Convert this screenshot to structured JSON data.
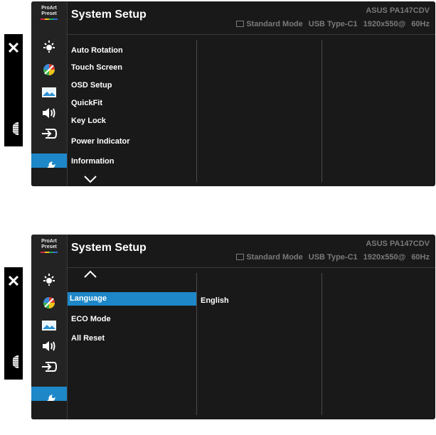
{
  "screen1": {
    "proart_line1": "ProArt",
    "proart_line2": "Preset",
    "title": "System Setup",
    "model": "ASUS PA147CDV",
    "status": {
      "mode": "Standard Mode",
      "input": "USB Type-C1",
      "resolution": "1920x550@",
      "refresh": "60Hz"
    },
    "menu_items": [
      "Auto Rotation",
      "Touch Screen",
      "OSD Setup",
      "QuickFit",
      "Key Lock",
      "Power Indicator",
      "Information"
    ],
    "scroll_icon": "chevron-down-icon"
  },
  "screen2": {
    "proart_line1": "ProArt",
    "proart_line2": "Preset",
    "title": "System Setup",
    "model": "ASUS PA147CDV",
    "status": {
      "mode": "Standard Mode",
      "input": "USB Type-C1",
      "resolution": "1920x550@",
      "refresh": "60Hz"
    },
    "menu_items": [
      "Language",
      "ECO Mode",
      "All Reset"
    ],
    "selected_item": "Language",
    "selected_value": "English",
    "scroll_icon": "chevron-up-icon"
  },
  "side_icons": [
    "brightness-icon",
    "color-icon",
    "image-icon",
    "sound-icon",
    "input-select-icon",
    "system-setup-icon"
  ],
  "external_controls": [
    "close-icon",
    "scroll-wheel-icon"
  ],
  "colors": {
    "accent": "#1d87c8",
    "panel": "#191919",
    "sidebar": "#232323",
    "status_text": "#7a7a7a"
  }
}
